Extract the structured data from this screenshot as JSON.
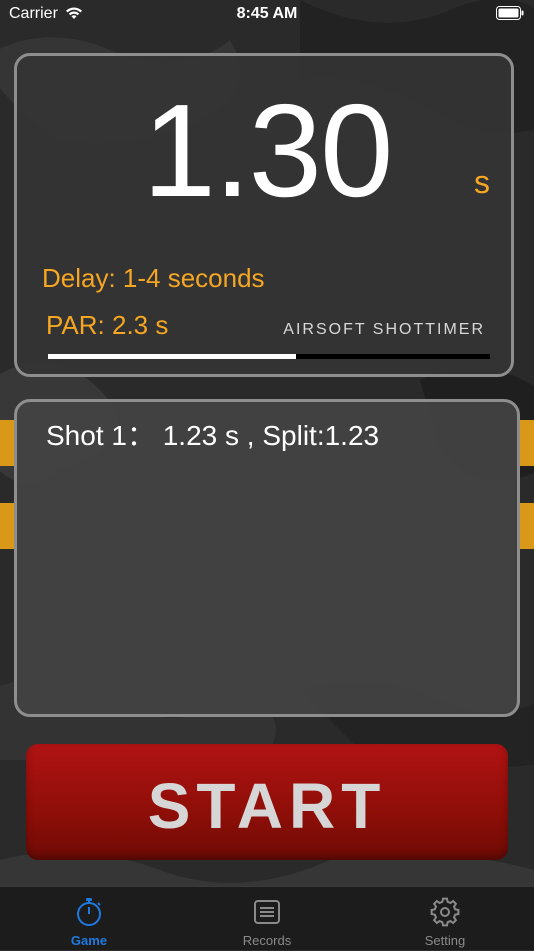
{
  "status_bar": {
    "carrier": "Carrier",
    "time": "8:45 AM"
  },
  "timer": {
    "value": "1.30",
    "unit": "s",
    "delay": "Delay: 1-4 seconds",
    "par": "PAR: 2.3 s",
    "brand": "AIRSOFT SHOTTIMER",
    "progress_fraction": 0.56
  },
  "shots": [
    {
      "text": "Shot 1： 1.23 s , Split:1.23"
    }
  ],
  "start_label": "START",
  "tabs": [
    {
      "label": "Game",
      "icon": "stopwatch-icon",
      "active": true
    },
    {
      "label": "Records",
      "icon": "records-icon",
      "active": false
    },
    {
      "label": "Setting",
      "icon": "gear-icon",
      "active": false
    }
  ],
  "colors": {
    "accent": "#f5a623",
    "tab_active": "#1f7ae0",
    "start_red": "#a01010",
    "panel_border": "#8e8e8e"
  }
}
